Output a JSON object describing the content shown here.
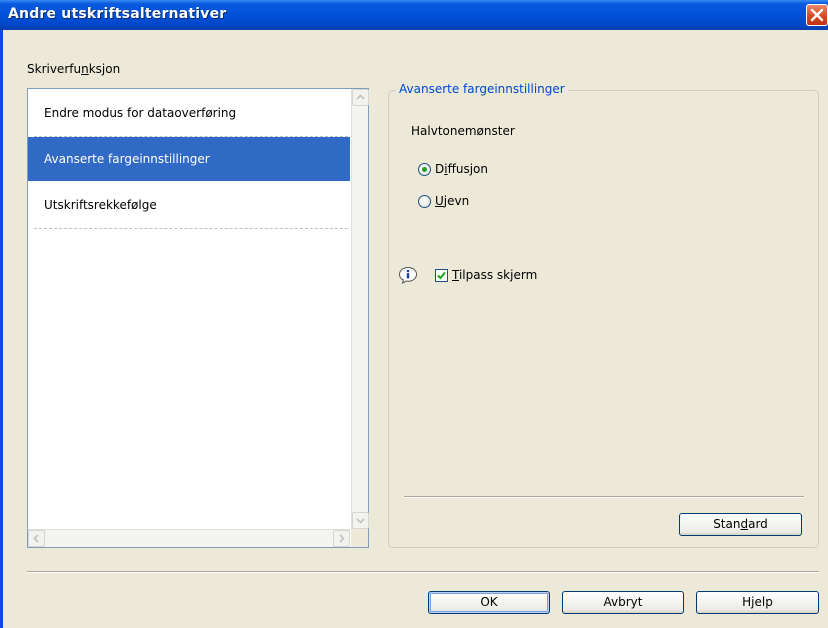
{
  "window": {
    "title": "Andre utskriftsalternativer"
  },
  "left_panel": {
    "label_pre": "Skriverfu",
    "label_accel": "n",
    "label_post": "ksjon",
    "items": [
      {
        "label": "Endre modus for dataoverføring"
      },
      {
        "label": "Avanserte fargeinnstillinger"
      },
      {
        "label": "Utskriftsrekkefølge"
      }
    ],
    "selected_index": 1
  },
  "group": {
    "title": "Avanserte fargeinnstillinger",
    "section_label": "Halvtonemønster",
    "radio_diffusion": {
      "pre": "D",
      "accel": "i",
      "post": "ffusjon",
      "checked": true
    },
    "radio_ujevn": {
      "pre": "",
      "accel": "U",
      "post": "jevn",
      "checked": false
    },
    "checkbox": {
      "pre": "",
      "accel": "T",
      "post": "ilpass skjerm",
      "checked": true
    },
    "standard_button": {
      "pre": "Stan",
      "accel": "d",
      "post": "ard"
    }
  },
  "buttons": {
    "ok": "OK",
    "cancel": "Avbryt",
    "help": "Hjelp"
  },
  "colors": {
    "selection": "#316ac5",
    "group_title": "#0046d5",
    "titlebar": "#0050d8"
  }
}
